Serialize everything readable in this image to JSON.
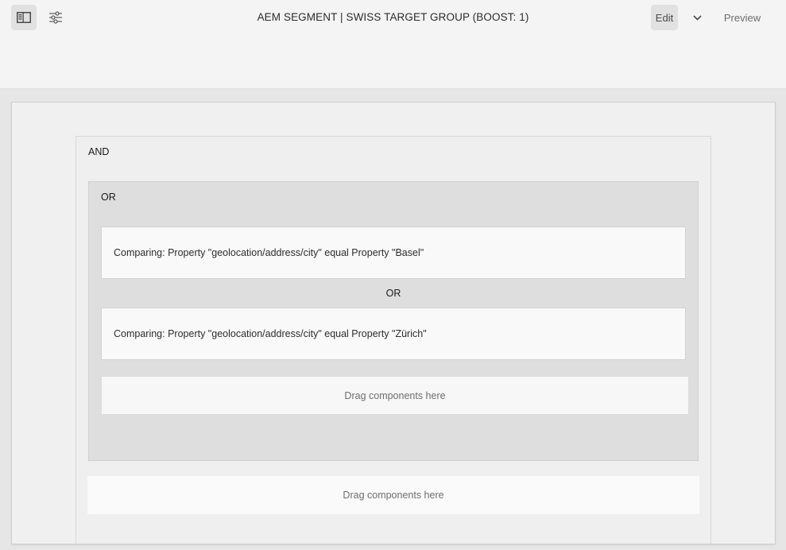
{
  "toolbar": {
    "title": "AEM SEGMENT | SWISS TARGET GROUP (BOOST: 1)",
    "edit_label": "Edit",
    "preview_label": "Preview",
    "icons": {
      "side_panel": "side-panel-icon",
      "properties": "sliders-icon",
      "mode_menu": "chevron-down-icon"
    }
  },
  "segment": {
    "and_label": "AND",
    "or_group": {
      "label": "OR",
      "conditions": [
        "Comparing: Property \"geolocation/address/city\" equal  Property \"Basel\"",
        "Comparing: Property \"geolocation/address/city\" equal  Property \"Zürich\""
      ],
      "separator": "OR",
      "drop_zone": "Drag components here"
    },
    "drop_zone": "Drag components here"
  }
}
